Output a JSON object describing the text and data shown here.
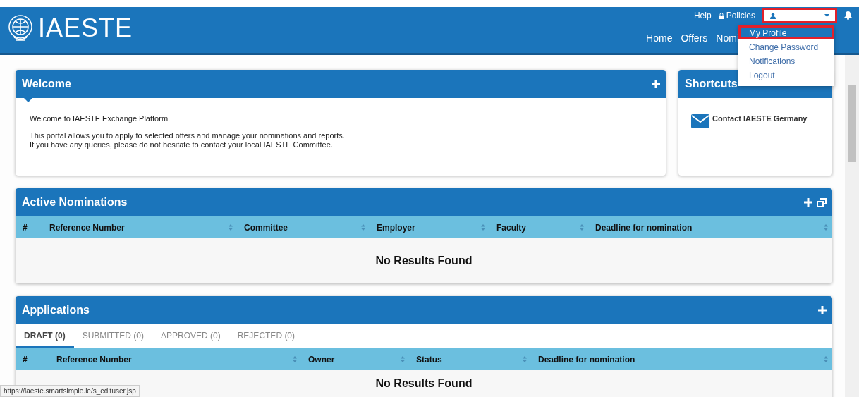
{
  "header": {
    "logo_text": "IAESTE",
    "top_links": [
      {
        "label": "Help",
        "kind": "plain"
      },
      {
        "label": "Policies",
        "kind": "lock"
      }
    ],
    "nav": [
      "Home",
      "Offers",
      "Nomi"
    ]
  },
  "user_menu": {
    "items": [
      {
        "label": "My Profile",
        "selected": true
      },
      {
        "label": "Change Password",
        "selected": false
      },
      {
        "label": "Notifications",
        "selected": false
      },
      {
        "label": "Logout",
        "selected": false
      }
    ]
  },
  "welcome": {
    "title": "Welcome",
    "lines": [
      "Welcome to IAESTE Exchange Platform.",
      "This portal allows you to apply to selected offers and manage your nominations and reports.",
      "If you have any queries, please do not hesitate to contact your local IAESTE Committee."
    ]
  },
  "shortcuts": {
    "title": "Shortcuts",
    "items": [
      "Contact IAESTE Germany"
    ]
  },
  "active_nominations": {
    "title": "Active Nominations",
    "columns": [
      {
        "label": "#",
        "sortable": false
      },
      {
        "label": "Reference Number",
        "sortable": true
      },
      {
        "label": "Committee",
        "sortable": true
      },
      {
        "label": "Employer",
        "sortable": true
      },
      {
        "label": "Faculty",
        "sortable": true
      },
      {
        "label": "Deadline for nomination",
        "sortable": true
      }
    ],
    "empty_text": "No Results Found"
  },
  "applications": {
    "title": "Applications",
    "tabs": [
      {
        "label": "DRAFT (0)",
        "selected": true
      },
      {
        "label": "SUBMITTED (0)",
        "selected": false
      },
      {
        "label": "APPROVED (0)",
        "selected": false
      },
      {
        "label": "REJECTED (0)",
        "selected": false
      }
    ],
    "columns": [
      {
        "label": "#",
        "sortable": false
      },
      {
        "label": "Reference Number",
        "sortable": true
      },
      {
        "label": "Owner",
        "sortable": true
      },
      {
        "label": "Status",
        "sortable": true
      },
      {
        "label": "Deadline for nomination",
        "sortable": true
      }
    ],
    "empty_text": "No Results Found"
  },
  "status_bar": {
    "url": "https://iaeste.smartsimple.ie/s_edituser.jsp"
  }
}
